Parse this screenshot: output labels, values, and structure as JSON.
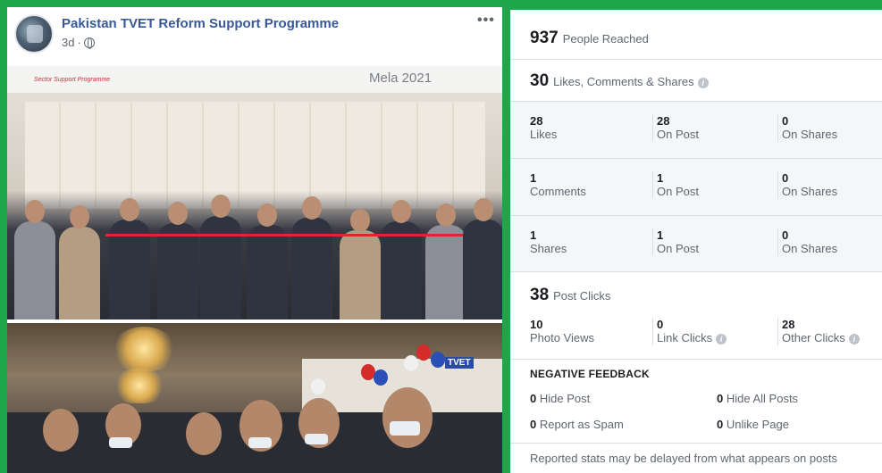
{
  "post": {
    "page_name": "Pakistan TVET Reform Support Programme",
    "time": "3d",
    "time_separator": "·",
    "more_icon": "more-options-icon",
    "privacy_icon": "globe-icon",
    "photo_top": {
      "banner_text": "Mela 2021",
      "banner_sub": "Sector Support Programme"
    },
    "photo_bottom": {
      "stall_tag": "TVET"
    }
  },
  "stats": {
    "reach": {
      "value": "937",
      "label": "People Reached"
    },
    "engagement": {
      "value": "30",
      "label": "Likes, Comments & Shares"
    },
    "likes": {
      "total": "28",
      "total_label": "Likes",
      "on_post": "28",
      "on_post_label": "On Post",
      "on_shares": "0",
      "on_shares_label": "On Shares"
    },
    "comments": {
      "total": "1",
      "total_label": "Comments",
      "on_post": "1",
      "on_post_label": "On Post",
      "on_shares": "0",
      "on_shares_label": "On Shares"
    },
    "shares": {
      "total": "1",
      "total_label": "Shares",
      "on_post": "1",
      "on_post_label": "On Post",
      "on_shares": "0",
      "on_shares_label": "On Shares"
    },
    "clicks": {
      "value": "38",
      "label": "Post Clicks"
    },
    "click_breakdown": {
      "photo_views": "10",
      "photo_views_label": "Photo Views",
      "link_clicks": "0",
      "link_clicks_label": "Link Clicks",
      "other_clicks": "28",
      "other_clicks_label": "Other Clicks"
    },
    "negative_feedback": {
      "title": "NEGATIVE FEEDBACK",
      "hide_post": "0",
      "hide_post_label": "Hide Post",
      "hide_all": "0",
      "hide_all_label": "Hide All Posts",
      "spam": "0",
      "spam_label": "Report as Spam",
      "unlike": "0",
      "unlike_label": "Unlike Page"
    },
    "footer": "Reported stats may be delayed from what appears on posts",
    "info_glyph": "i"
  },
  "colors": {
    "frame": "#1ea64b",
    "page_name": "#385898",
    "muted": "#606770",
    "divider": "#dadde1"
  }
}
